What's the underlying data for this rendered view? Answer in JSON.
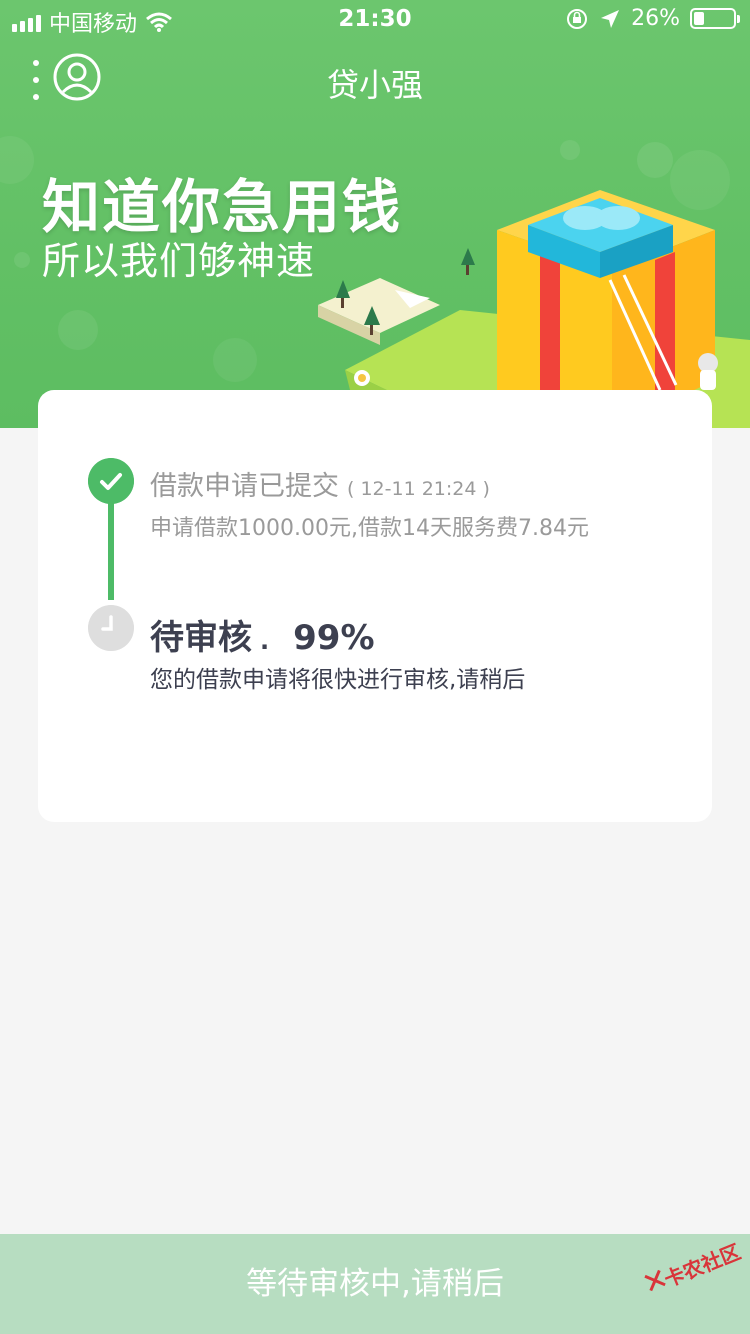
{
  "status_bar": {
    "carrier": "中国移动",
    "time": "21:30",
    "battery_percent": "26%",
    "battery_level": 0.26,
    "icons": [
      "signal-icon",
      "wifi-icon",
      "orientation-lock-icon",
      "location-icon",
      "battery-icon"
    ]
  },
  "navbar": {
    "title": "贷小强",
    "menu_icon": "more-vertical-icon",
    "user_icon": "user-icon"
  },
  "hero": {
    "title": "知道你急用钱",
    "subtitle": "所以我们够神速"
  },
  "progress": {
    "step1": {
      "title": "借款申请已提交",
      "time": "( 12-11 21:24 )",
      "description": "申请借款1000.00元,借款14天服务费7.84元",
      "icon": "check-icon"
    },
    "step2": {
      "title": "待审核",
      "dot": ".",
      "percent": "99%",
      "description": "您的借款申请将很快进行审核,请稍后",
      "icon": "clock-icon"
    }
  },
  "bottom_bar": {
    "label": "等待审核中,请稍后"
  },
  "watermark": {
    "text": "卡农社区"
  },
  "colors": {
    "brand_green": "#62c065",
    "step_done": "#4dbb67",
    "step_pending": "#dedede",
    "bottom_bar": "#b7ddc1",
    "text_dark": "#3d4050",
    "text_muted": "#9a9a9a"
  }
}
